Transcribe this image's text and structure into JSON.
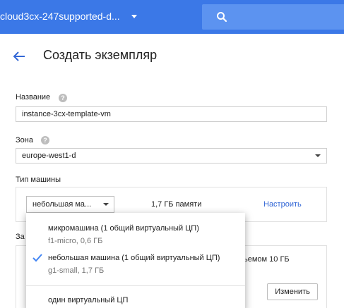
{
  "topbar": {
    "project_name": "cloud3cx-247supported-d...",
    "search_icon": "search-icon",
    "project_caret_icon": "caret-down-icon"
  },
  "page": {
    "back_icon": "arrow-back-icon",
    "title": "Создать экземпляр"
  },
  "form": {
    "name_label": "Название",
    "name_value": "instance-3cx-template-vm",
    "zone_label": "Зона",
    "zone_value": "europe-west1-d",
    "machine_type_label": "Тип машины",
    "machine_type_value": "небольшая ма...",
    "memory_text": "1,7 ГБ памяти",
    "customize_link": "Настроить",
    "boot_disk_label_partial": "За",
    "boot_disk_size_text": "ьемом 10 ГБ",
    "change_button": "Изменить"
  },
  "dropdown": {
    "options": [
      {
        "title": "микромашина (1 общий виртуальный ЦП)",
        "subtitle": "f1-micro, 0,6 ГБ",
        "selected": false
      },
      {
        "title": "небольшая машина (1 общий виртуальный ЦП)",
        "subtitle": "g1-small, 1,7 ГБ",
        "selected": true
      },
      {
        "title": "один виртуальный ЦП",
        "subtitle": "",
        "selected": false
      }
    ],
    "check_icon": "checkmark-icon"
  },
  "colors": {
    "topbar": "#3b78e7",
    "search_box": "#5c93f0",
    "accent": "#3367d6",
    "check": "#4285f4"
  }
}
